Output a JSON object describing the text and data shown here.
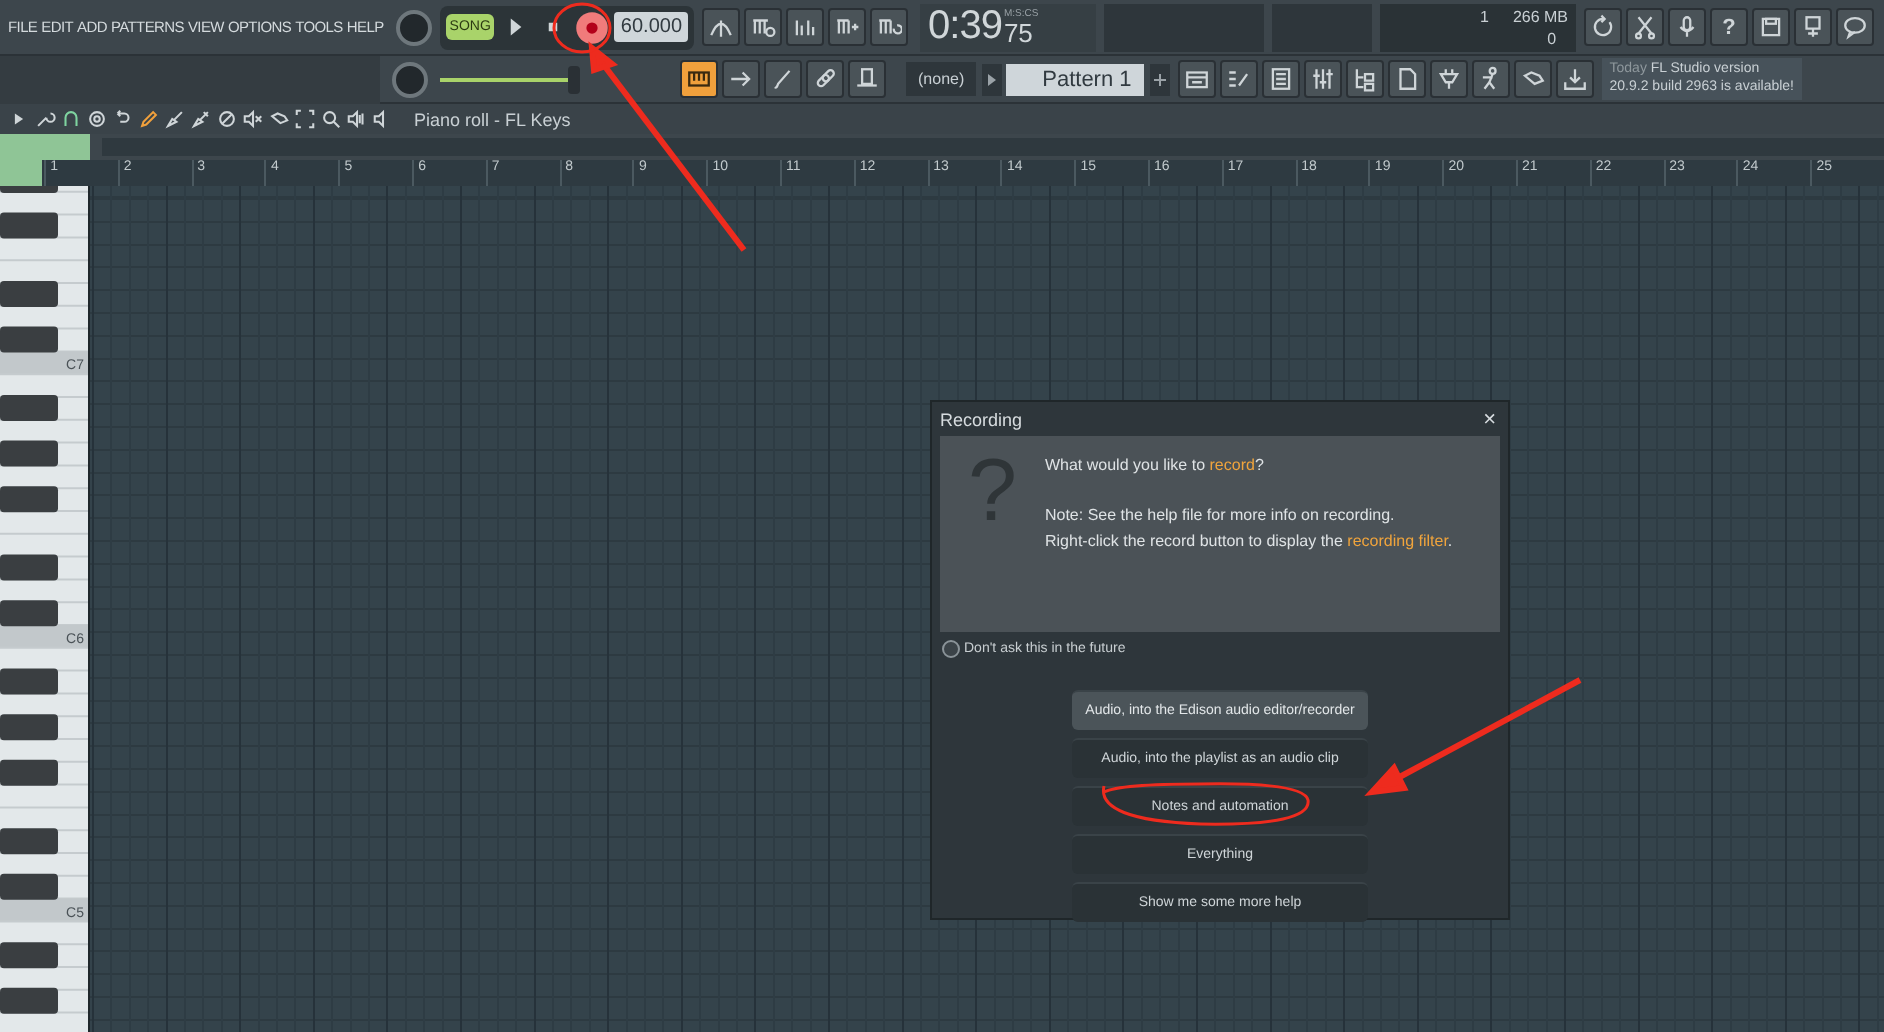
{
  "menu": [
    "FILE",
    "EDIT",
    "ADD",
    "PATTERNS",
    "VIEW",
    "OPTIONS",
    "TOOLS",
    "HELP"
  ],
  "transport": {
    "mode": "SONG",
    "record_on": true,
    "tempo": "60.000"
  },
  "time": {
    "main": "0:39",
    "sub": "75",
    "unit": "M:S:CS"
  },
  "monitor": {
    "voices": "1",
    "memory": "266 MB",
    "cpu": "0"
  },
  "help_label": "?",
  "master_volume": {
    "level": 0.95
  },
  "view_buttons": [
    {
      "on": true
    },
    {
      "on": false
    },
    {
      "on": false
    },
    {
      "on": false
    },
    {
      "on": false
    }
  ],
  "pattern": {
    "channel": "(none)",
    "name": "Pattern 1"
  },
  "hint": {
    "when": "Today",
    "line1": "FL Studio version",
    "line2": "20.9.2 build 2963 is available!"
  },
  "piano_roll": {
    "title": "Piano roll - FL Keys"
  },
  "ruler": [
    "1",
    "2",
    "3",
    "4",
    "5",
    "6",
    "7",
    "8",
    "9",
    "10",
    "11",
    "12",
    "13",
    "14",
    "15",
    "16",
    "17",
    "18",
    "19",
    "20",
    "21",
    "22",
    "23",
    "24",
    "25"
  ],
  "octave_labels": [
    "C7",
    "C6",
    "C5"
  ],
  "dialog": {
    "title": "Recording",
    "close": "×",
    "glyph": "?",
    "lines": [
      {
        "text": "What would you like to ",
        "link": "record",
        "after": "?"
      },
      {
        "text": "Note: See the help file for more info on recording."
      },
      {
        "text": "Right-click the record button to display the ",
        "link": "recording filter",
        "after": "."
      }
    ],
    "dont_ask": {
      "label": "Don't ask this in the future",
      "checked": false
    },
    "options": [
      {
        "label": "Audio, into the Edison audio editor/recorder",
        "selected": true
      },
      {
        "label": "Audio, into the playlist as an audio clip",
        "selected": false
      },
      {
        "label": "Notes and automation",
        "selected": false
      },
      {
        "label": "Everything",
        "selected": false
      },
      {
        "label": "Show me some more help",
        "selected": false
      }
    ]
  }
}
